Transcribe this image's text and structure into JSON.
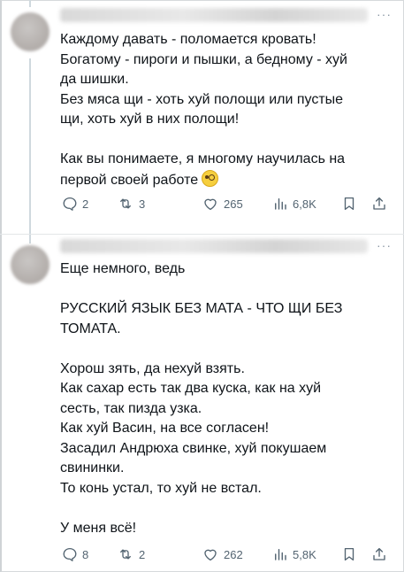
{
  "tweets": [
    {
      "text_lines": [
        "Каждому давать - поломается кровать!",
        "Богатому - пироги и пышки, а бедному - хуй",
        "да шишки.",
        "Без мяса щи - хоть хуй полощи или пустые",
        "щи, хоть хуй в них полощи!",
        "",
        "Как вы понимаете, я многому научилась на",
        "первой своей работе"
      ],
      "emoji": "flushed-face-emoji",
      "stats": {
        "replies": "2",
        "retweets": "3",
        "likes": "265",
        "views": "6,8K"
      }
    },
    {
      "text_lines": [
        "Еще немного, ведь",
        "",
        "РУССКИЙ ЯЗЫК БЕЗ МАТА - ЧТО ЩИ БЕЗ",
        "ТОМАТА.",
        "",
        "Хорош зять, да нехуй взять.",
        "Как сахар есть так два куска, как на хуй",
        "сесть, так пизда узка.",
        "Как хуй Васин, на все согласен!",
        "Засадил Андрюха свинке, хуй покушаем",
        "свининки.",
        "То конь устал, то хуй не встал.",
        "",
        "У меня всё!"
      ],
      "stats": {
        "replies": "8",
        "retweets": "2",
        "likes": "262",
        "views": "5,8K"
      }
    }
  ],
  "more_label": "···",
  "icons": [
    "reply-icon",
    "retweet-icon",
    "like-icon",
    "views-icon",
    "bookmark-icon",
    "share-icon",
    "more-icon"
  ]
}
